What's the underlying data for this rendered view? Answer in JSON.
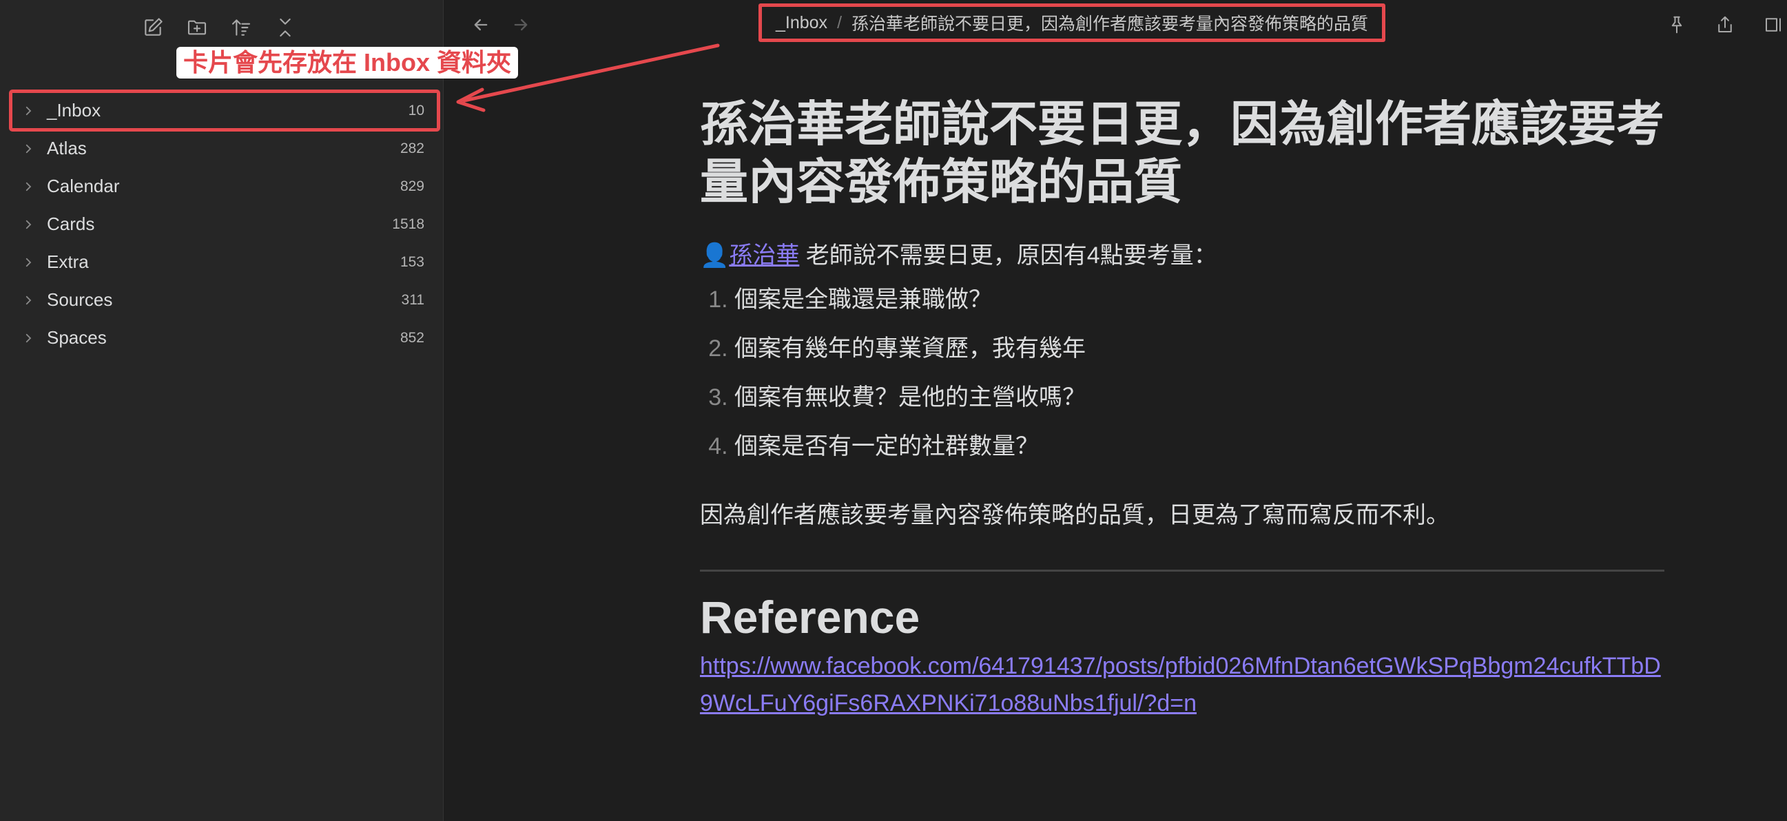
{
  "sidebar": {
    "callout": "卡片會先存放在 Inbox 資料夾",
    "folders": [
      {
        "name": "_Inbox",
        "count": "10"
      },
      {
        "name": "Atlas",
        "count": "282"
      },
      {
        "name": "Calendar",
        "count": "829"
      },
      {
        "name": "Cards",
        "count": "1518"
      },
      {
        "name": "Extra",
        "count": "153"
      },
      {
        "name": "Sources",
        "count": "311"
      },
      {
        "name": "Spaces",
        "count": "852"
      }
    ]
  },
  "header": {
    "breadcrumb_folder": "_Inbox",
    "breadcrumb_sep": "/",
    "breadcrumb_note": "孫治華老師說不要日更，因為創作者應該要考量內容發佈策略的品質"
  },
  "note": {
    "title": "孫治華老師說不要日更，因為創作者應該要考量內容發佈策略的品質",
    "person_icon": "👤",
    "person_link": "孫治華",
    "intro_rest": " 老師說不需要日更，原因有4點要考量：",
    "points": [
      "個案是全職還是兼職做？",
      "個案有幾年的專業資歷，我有幾年",
      "個案有無收費？是他的主營收嗎？",
      "個案是否有一定的社群數量？"
    ],
    "paragraph": "因為創作者應該要考量內容發佈策略的品質，日更為了寫而寫反而不利。",
    "reference_heading": "Reference",
    "reference_url": "https://www.facebook.com/641791437/posts/pfbid026MfnDtan6etGWkSPqBbgm24cufkTTbD9WcLFuY6giFs6RAXPNKi71o88uNbs1fjul/?d=n"
  },
  "colors": {
    "annotation_red": "#e5484d",
    "link_purple": "#8b7cf6",
    "background": "#1e1e1e",
    "sidebar_bg": "#262626"
  }
}
